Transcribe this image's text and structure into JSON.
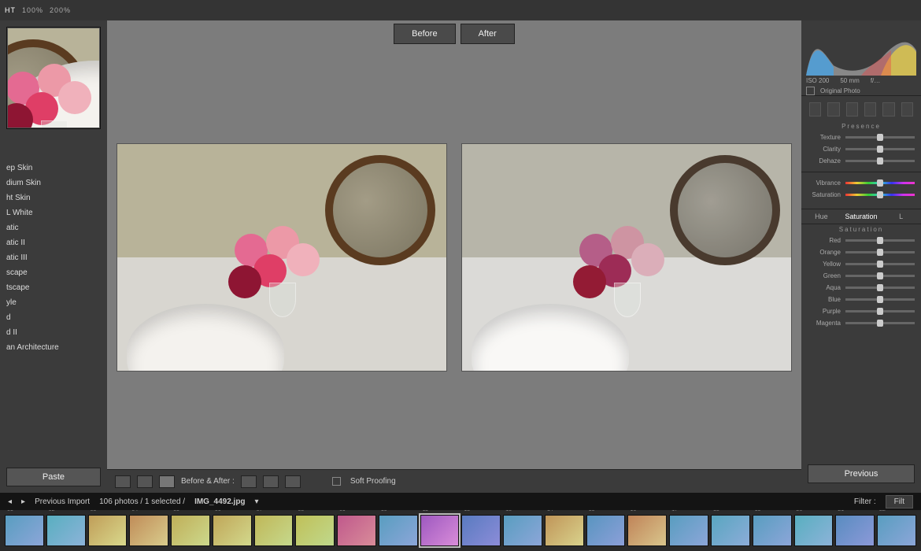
{
  "topbar": {
    "zoom_levels": [
      "HT",
      "100%",
      "200%"
    ],
    "zoom_active": 0
  },
  "compare": {
    "before": "Before",
    "after": "After"
  },
  "left": {
    "presets": [
      "ep Skin",
      "dium Skin",
      "ht Skin",
      "L White",
      "atic",
      "atic II",
      "atic III",
      "scape",
      "tscape",
      "yle",
      "d",
      "d II",
      "an Architecture"
    ],
    "paste": "Paste"
  },
  "mid_toolbar": {
    "ba_label": "Before & After :",
    "soft_proofing": "Soft Proofing"
  },
  "right": {
    "histo": {
      "iso": "ISO 200",
      "focal": "50 mm",
      "aperture": "f/…"
    },
    "orig_photo": "Original Photo",
    "presence": {
      "title": "Presence",
      "sliders": [
        "Texture",
        "Clarity",
        "Dehaze"
      ]
    },
    "vib": [
      "Vibrance",
      "Saturation"
    ],
    "subtabs": [
      "Hue",
      "Saturation",
      "L"
    ],
    "subtab_active": 1,
    "sat": {
      "title": "Saturation",
      "sliders": [
        "Red",
        "Orange",
        "Yellow",
        "Green",
        "Aqua",
        "Blue",
        "Purple",
        "Magenta"
      ]
    },
    "previous": "Previous"
  },
  "infobar": {
    "left_arrow": "◂",
    "right_arrow": "▸",
    "breadcrumb": "Previous Import",
    "count": "106 photos / 1 selected /",
    "filename": "IMG_4492.jpg",
    "filter_label": "Filter :",
    "filter_btn": "Filt"
  },
  "filmstrip_count": 22,
  "filmstrip_selected": 10
}
